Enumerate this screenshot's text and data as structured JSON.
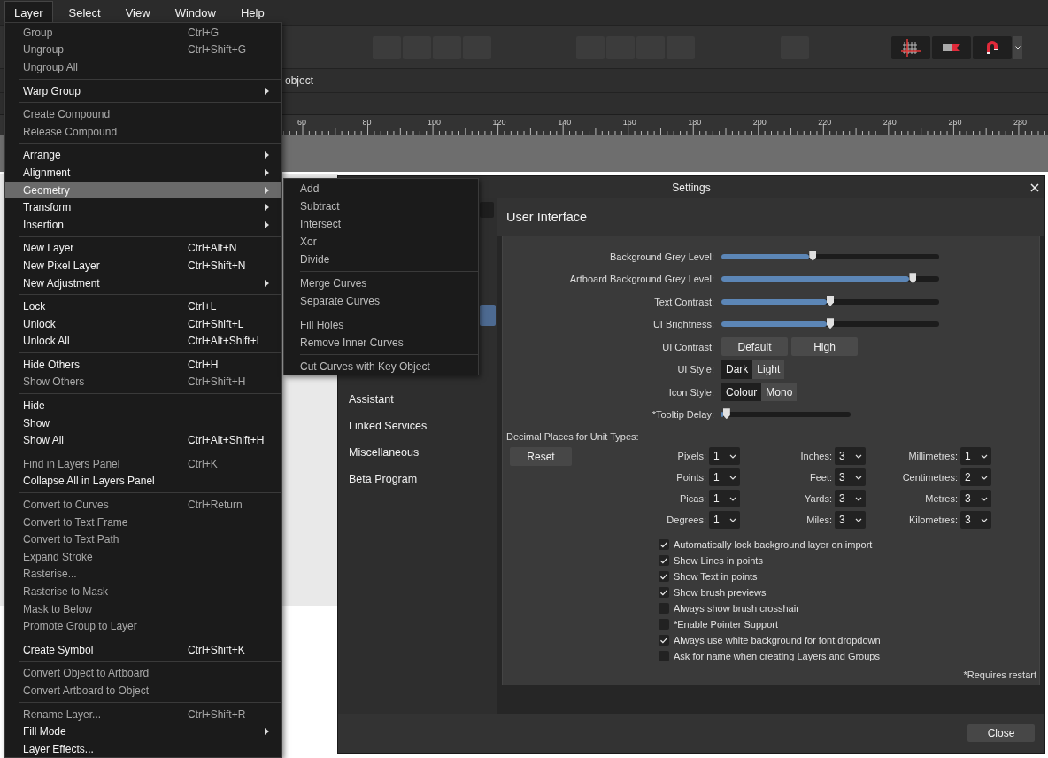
{
  "menubar": [
    {
      "label": "Layer",
      "selected": true
    },
    {
      "label": "Select",
      "selected": false
    },
    {
      "label": "View",
      "selected": false
    },
    {
      "label": "Window",
      "selected": false
    },
    {
      "label": "Help",
      "selected": false
    }
  ],
  "context_bar": {
    "text": "object"
  },
  "ruler": {
    "labels": [
      "60",
      "80",
      "100",
      "120",
      "140",
      "160",
      "180",
      "200",
      "220",
      "240",
      "260",
      "280"
    ]
  },
  "layer_menu": {
    "sections": [
      [
        {
          "label": "Group",
          "shortcut": "Ctrl+G",
          "disabled": true,
          "has_submenu": false,
          "selected": false
        },
        {
          "label": "Ungroup",
          "shortcut": "Ctrl+Shift+G",
          "disabled": true,
          "has_submenu": false,
          "selected": false
        },
        {
          "label": "Ungroup All",
          "disabled": true,
          "has_submenu": false,
          "selected": false
        }
      ],
      [
        {
          "label": "Warp Group",
          "disabled": false,
          "has_submenu": true,
          "selected": false
        }
      ],
      [
        {
          "label": "Create Compound",
          "disabled": true,
          "has_submenu": false,
          "selected": false
        },
        {
          "label": "Release Compound",
          "disabled": true,
          "has_submenu": false,
          "selected": false
        }
      ],
      [
        {
          "label": "Arrange",
          "disabled": false,
          "has_submenu": true,
          "selected": false
        },
        {
          "label": "Alignment",
          "disabled": false,
          "has_submenu": true,
          "selected": false
        },
        {
          "label": "Geometry",
          "disabled": false,
          "has_submenu": true,
          "selected": true
        },
        {
          "label": "Transform",
          "disabled": false,
          "has_submenu": true,
          "selected": false
        },
        {
          "label": "Insertion",
          "disabled": false,
          "has_submenu": true,
          "selected": false
        }
      ],
      [
        {
          "label": "New Layer",
          "shortcut": "Ctrl+Alt+N",
          "disabled": false,
          "has_submenu": false,
          "selected": false
        },
        {
          "label": "New Pixel Layer",
          "shortcut": "Ctrl+Shift+N",
          "disabled": false,
          "has_submenu": false,
          "selected": false
        },
        {
          "label": "New Adjustment",
          "disabled": false,
          "has_submenu": true,
          "selected": false
        }
      ],
      [
        {
          "label": "Lock",
          "shortcut": "Ctrl+L",
          "disabled": false,
          "has_submenu": false,
          "selected": false
        },
        {
          "label": "Unlock",
          "shortcut": "Ctrl+Shift+L",
          "disabled": false,
          "has_submenu": false,
          "selected": false
        },
        {
          "label": "Unlock All",
          "shortcut": "Ctrl+Alt+Shift+L",
          "disabled": false,
          "has_submenu": false,
          "selected": false
        }
      ],
      [
        {
          "label": "Hide Others",
          "shortcut": "Ctrl+H",
          "disabled": false,
          "has_submenu": false,
          "selected": false
        },
        {
          "label": "Show Others",
          "shortcut": "Ctrl+Shift+H",
          "disabled": true,
          "has_submenu": false,
          "selected": false
        }
      ],
      [
        {
          "label": "Hide",
          "disabled": false,
          "has_submenu": false,
          "selected": false
        },
        {
          "label": "Show",
          "disabled": false,
          "has_submenu": false,
          "selected": false
        },
        {
          "label": "Show All",
          "shortcut": "Ctrl+Alt+Shift+H",
          "disabled": false,
          "has_submenu": false,
          "selected": false
        }
      ],
      [
        {
          "label": "Find in Layers Panel",
          "shortcut": "Ctrl+K",
          "disabled": true,
          "has_submenu": false,
          "selected": false
        },
        {
          "label": "Collapse All in Layers Panel",
          "disabled": false,
          "has_submenu": false,
          "selected": false
        }
      ],
      [
        {
          "label": "Convert to Curves",
          "shortcut": "Ctrl+Return",
          "disabled": true,
          "has_submenu": false,
          "selected": false
        },
        {
          "label": "Convert to Text Frame",
          "disabled": true,
          "has_submenu": false,
          "selected": false
        },
        {
          "label": "Convert to Text Path",
          "disabled": true,
          "has_submenu": false,
          "selected": false
        },
        {
          "label": "Expand Stroke",
          "disabled": true,
          "has_submenu": false,
          "selected": false
        },
        {
          "label": "Rasterise...",
          "disabled": true,
          "has_submenu": false,
          "selected": false
        },
        {
          "label": "Rasterise to Mask",
          "disabled": true,
          "has_submenu": false,
          "selected": false
        },
        {
          "label": "Mask to Below",
          "disabled": true,
          "has_submenu": false,
          "selected": false
        },
        {
          "label": "Promote Group to Layer",
          "disabled": true,
          "has_submenu": false,
          "selected": false
        }
      ],
      [
        {
          "label": "Create Symbol",
          "shortcut": "Ctrl+Shift+K",
          "disabled": false,
          "has_submenu": false,
          "selected": false
        }
      ],
      [
        {
          "label": "Convert Object to Artboard",
          "disabled": true,
          "has_submenu": false,
          "selected": false
        },
        {
          "label": "Convert Artboard to Object",
          "disabled": true,
          "has_submenu": false,
          "selected": false
        }
      ],
      [
        {
          "label": "Rename Layer...",
          "shortcut": "Ctrl+Shift+R",
          "disabled": true,
          "has_submenu": false,
          "selected": false
        },
        {
          "label": "Fill Mode",
          "disabled": false,
          "has_submenu": true,
          "selected": false
        },
        {
          "label": "Layer Effects...",
          "disabled": false,
          "has_submenu": false,
          "selected": false
        }
      ]
    ]
  },
  "geometry_submenu": {
    "sections": [
      [
        {
          "label": "Add",
          "disabled": true
        },
        {
          "label": "Subtract",
          "disabled": true
        },
        {
          "label": "Intersect",
          "disabled": true
        },
        {
          "label": "Xor",
          "disabled": true
        },
        {
          "label": "Divide",
          "disabled": true
        }
      ],
      [
        {
          "label": "Merge Curves",
          "disabled": true
        },
        {
          "label": "Separate Curves",
          "disabled": true
        }
      ],
      [
        {
          "label": "Fill Holes",
          "disabled": true
        },
        {
          "label": "Remove Inner Curves",
          "disabled": true
        }
      ],
      [
        {
          "label": "Cut Curves with Key Object",
          "disabled": true
        }
      ]
    ]
  },
  "settings": {
    "title": "Settings",
    "sidebar": [
      {
        "label": "Assistant",
        "selected": false
      },
      {
        "label": "Linked Services",
        "selected": false
      },
      {
        "label": "Miscellaneous",
        "selected": false
      },
      {
        "label": "Beta Program",
        "selected": false
      }
    ],
    "heading": "User Interface",
    "rows": [
      {
        "kind": "slider",
        "label": "Background Grey Level:",
        "level": 0.42
      },
      {
        "kind": "slider",
        "label": "Artboard Background Grey Level:",
        "level": 0.88
      },
      {
        "kind": "slider",
        "label": "Text Contrast:",
        "level": 0.5
      },
      {
        "kind": "slider",
        "label": "UI Brightness:",
        "level": 0.5
      },
      {
        "kind": "buttons",
        "label": "UI Contrast:",
        "options": [
          {
            "label": "Default",
            "selected": false
          },
          {
            "label": "High",
            "selected": false
          }
        ]
      },
      {
        "kind": "segmented",
        "label": "UI Style:",
        "options": [
          {
            "label": "Dark",
            "selected": true
          },
          {
            "label": "Light",
            "selected": false
          }
        ]
      },
      {
        "kind": "segmented",
        "label": "Icon Style:",
        "options": [
          {
            "label": "Colour",
            "selected": true
          },
          {
            "label": "Mono",
            "selected": false
          }
        ]
      },
      {
        "kind": "short_slider",
        "label": "*Tooltip Delay:",
        "level": 0.04
      }
    ],
    "decimal_heading": "Decimal Places for Unit Types:",
    "reset_button": "Reset",
    "units": [
      {
        "label": "Pixels:",
        "value": "1"
      },
      {
        "label": "Inches:",
        "value": "3"
      },
      {
        "label": "Millimetres:",
        "value": "1"
      },
      {
        "label": "Points:",
        "value": "1"
      },
      {
        "label": "Feet:",
        "value": "3"
      },
      {
        "label": "Centimetres:",
        "value": "2"
      },
      {
        "label": "Picas:",
        "value": "1"
      },
      {
        "label": "Yards:",
        "value": "3"
      },
      {
        "label": "Metres:",
        "value": "3"
      },
      {
        "label": "Degrees:",
        "value": "1"
      },
      {
        "label": "Miles:",
        "value": "3"
      },
      {
        "label": "Kilometres:",
        "value": "3"
      }
    ],
    "checkboxes": [
      {
        "label": "Automatically lock background layer on import",
        "checked": true
      },
      {
        "label": "Show Lines in points",
        "checked": true
      },
      {
        "label": "Show Text in points",
        "checked": true
      },
      {
        "label": "Show brush previews",
        "checked": true
      },
      {
        "label": "Always show brush crosshair",
        "checked": false
      },
      {
        "label": "*Enable Pointer Support",
        "checked": false
      },
      {
        "label": "Always use white background for font dropdown",
        "checked": true
      },
      {
        "label": "Ask for name when creating Layers and Groups",
        "checked": false
      }
    ],
    "note": "*Requires restart",
    "close_button": "Close"
  }
}
